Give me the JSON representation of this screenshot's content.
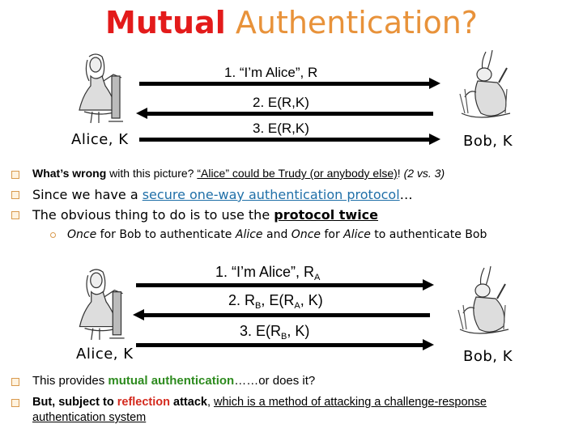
{
  "title": {
    "part1": "Mutual",
    "part2": "Authentication?"
  },
  "diagram1": {
    "messages": [
      {
        "label": "1. “I’m Alice”, R",
        "direction": "right"
      },
      {
        "label": "2. E(R,K)",
        "direction": "left"
      },
      {
        "label": "3. E(R,K)",
        "direction": "right"
      }
    ],
    "alice_label": "Alice, K",
    "bob_label": "Bob, K",
    "alice_icon": "alice-illustration",
    "bob_icon": "white-rabbit-illustration"
  },
  "bullets_top": [
    {
      "bold": "What’s wrong",
      "text": " with this picture? ",
      "underlined": "“Alice” could be Trudy (or anybody else)",
      "tail": "! ",
      "italic": "(2 vs. 3)"
    },
    {
      "text": "Since we have a ",
      "link": "secure one-way authentication protocol",
      "tail": "…"
    },
    {
      "text": "The obvious thing to do is to use the ",
      "bold_underlined": "protocol twice"
    }
  ],
  "sub_bullet": {
    "p1": "Once",
    "p2": " for Bob to authenticate ",
    "p3": "Alice",
    "p4": " and ",
    "p5": "Once",
    "p6": " for ",
    "p7": "Alice",
    "p8": " to authenticate Bob"
  },
  "diagram2": {
    "msg1": {
      "main": "1. “I’m Alice”, R",
      "sub": "A"
    },
    "msg2": {
      "a": "2. R",
      "a_sub": "B",
      "b": ", E(R",
      "b_sub": "A",
      "c": ", K)"
    },
    "msg3": {
      "a": "3. E(R",
      "a_sub": "B",
      "b": ", K)"
    },
    "alice_label": "Alice, K",
    "bob_label": "Bob, K"
  },
  "bullets_bottom": [
    {
      "text": "This provides ",
      "green": "mutual authentication",
      "tail": "……or does it?"
    },
    {
      "bold1": "But, subject to ",
      "red": "reflection",
      "bold2": " attack",
      "text": ", ",
      "underlined": "which is a method of attacking a challenge-response authentication system"
    }
  ],
  "colors": {
    "title_red": "#e31b1b",
    "title_orange": "#e8923a",
    "link_blue": "#1f6fa8",
    "green": "#2e8b1f",
    "red": "#d42a1e",
    "bullet_orange": "#d99a4e"
  }
}
